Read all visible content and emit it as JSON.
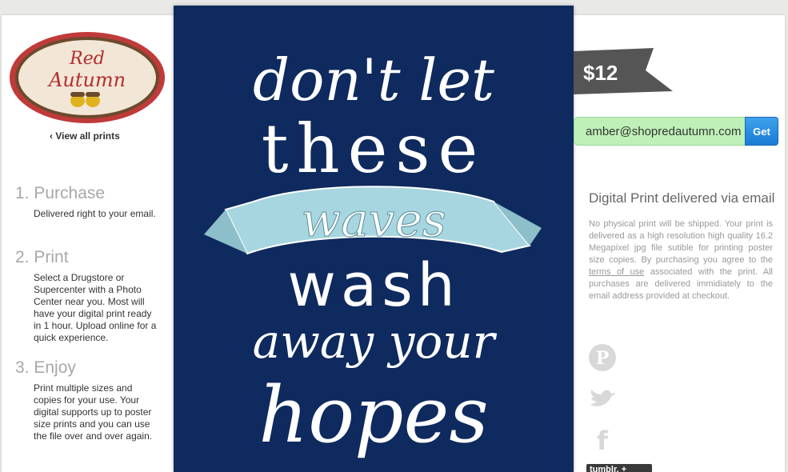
{
  "brand": {
    "logo_line1": "Red",
    "logo_line2": "Autumn"
  },
  "nav": {
    "view_all": "‹ View all prints"
  },
  "steps": [
    {
      "title": "1. Purchase",
      "desc": "Delivered right to your email."
    },
    {
      "title": "2. Print",
      "desc": "Select a Drugstore or Supercenter with a Photo Center near you. Most will have your digital print ready in 1 hour. Upload online for a quick experience."
    },
    {
      "title": "3. Enjoy",
      "desc": "Print multiple sizes and copies for your use. Your digital supports up to poster size prints and you can use the file over and over again."
    }
  ],
  "poster": {
    "line1": "don't let",
    "line2": "these",
    "line3": "waves",
    "line4": "wash",
    "line5": "away your",
    "line6": "hopes",
    "background": "#0e2a5e",
    "banner_color": "#a7d6e0"
  },
  "price": {
    "label": "$12"
  },
  "purchase": {
    "email_value": "amber@shopredautumn.com",
    "button_label": "Get"
  },
  "delivery": {
    "title": "Digital Print delivered via email",
    "desc_before": "No physical print will be shipped. Your print is delivered as a high resolution high quality 16.2 Megapixel jpg file sutible for printing poster size copies. By purchasing you agree to the ",
    "terms_link": "terms of use",
    "desc_after": " associated with the print. All purchases are delivered immidiately to the email address provided at checkout."
  },
  "social": {
    "tumblr_label": "tumblr. +"
  }
}
